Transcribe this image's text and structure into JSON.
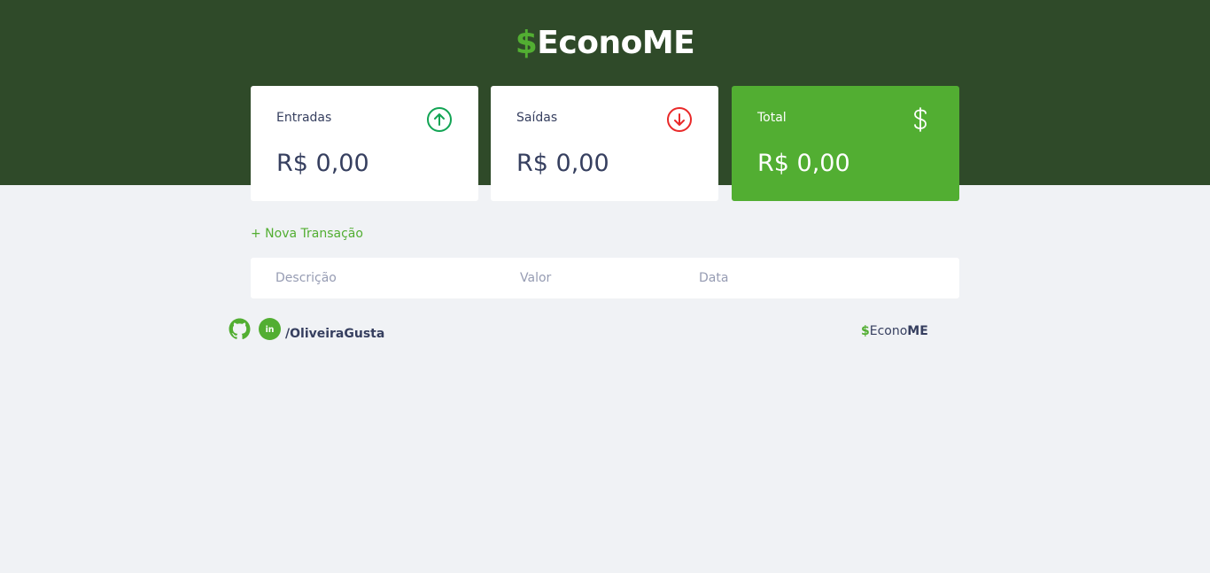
{
  "header": {
    "logo": {
      "symbol": "$",
      "prefix": "Econo",
      "suffix": "ME"
    }
  },
  "cards": {
    "income": {
      "label": "Entradas",
      "amount": "R$ 0,00",
      "icon": "arrow-up-circle-icon",
      "color": "#12a454"
    },
    "expense": {
      "label": "Saídas",
      "amount": "R$ 0,00",
      "icon": "arrow-down-circle-icon",
      "color": "#e92929"
    },
    "total": {
      "label": "Total",
      "amount": "R$ 0,00",
      "icon": "dollar-sign-icon",
      "color": "#52ae32"
    }
  },
  "actions": {
    "new_transaction": "+ Nova Transação"
  },
  "table": {
    "headers": [
      "Descrição",
      "Valor",
      "Data"
    ]
  },
  "footer": {
    "github_icon": "github-icon",
    "linkedin_icon": "linkedin-icon",
    "username": "/OliveiraGusta",
    "logo": {
      "symbol": "$",
      "prefix": "Econo",
      "suffix": "ME"
    }
  },
  "colors": {
    "header_bg": "#2f4a29",
    "accent": "#52ae32",
    "page_bg": "#f0f2f5",
    "text": "#363f5f",
    "muted": "#969cb3"
  }
}
